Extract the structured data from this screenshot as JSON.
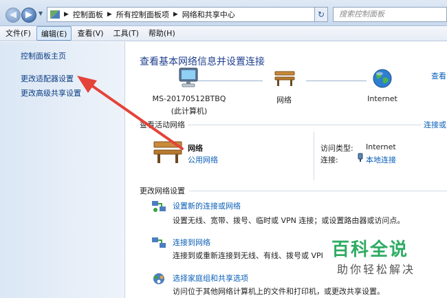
{
  "address_bar": {
    "crumbs": [
      "控制面板",
      "所有控制面板项",
      "网络和共享中心"
    ],
    "search_placeholder": "搜索控制面板"
  },
  "menu": [
    "文件(F)",
    "编辑(E)",
    "查看(V)",
    "工具(T)",
    "帮助(H)"
  ],
  "left_pane": {
    "links": [
      "控制面板主页",
      "更改适配器设置",
      "更改高级共享设置"
    ]
  },
  "main": {
    "title": "查看基本网络信息并设置连接",
    "view_full_map": "查看",
    "map": {
      "computer_name": "MS-20170512BTBQ",
      "computer_sub": "(此计算机)",
      "network": "网络",
      "internet": "Internet"
    },
    "active_header": "查看活动网络",
    "connect_link": "连接或",
    "active": {
      "name": "网络",
      "type": "公用网络",
      "access_label": "访问类型:",
      "access_value": "Internet",
      "conn_label": "连接:",
      "conn_value": "本地连接"
    },
    "change_header": "更改网络设置",
    "tasks": [
      {
        "title": "设置新的连接或网络",
        "desc": "设置无线、宽带、拨号、临时或 VPN 连接；或设置路由器或访问点。"
      },
      {
        "title": "连接到网络",
        "desc": "连接到或重新连接到无线、有线、拨号或 VPI"
      },
      {
        "title": "选择家庭组和共享选项",
        "desc": "访问位于其他网络计算机上的文件和打印机，或更改共享设置。"
      }
    ]
  },
  "watermark": {
    "line1": "百科全说",
    "line2": "助你轻松解决"
  },
  "colors": {
    "accent_link": "#0b5fb8",
    "heading": "#1e3f8c",
    "arrow": "#e4433a",
    "watermark": "#2eab62"
  }
}
